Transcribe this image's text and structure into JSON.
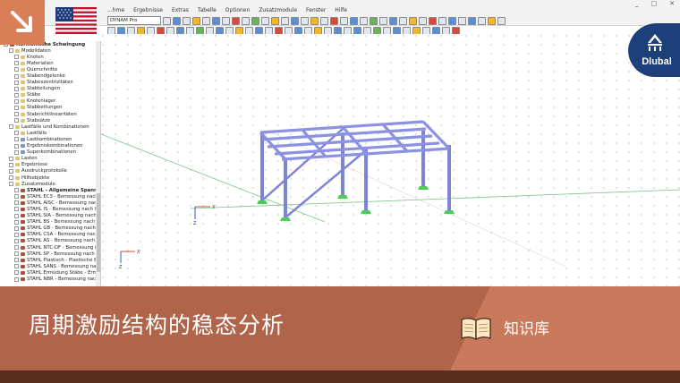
{
  "menu": {
    "items": [
      "...hme",
      "Ergebnisse",
      "Extras",
      "Tabelle",
      "Optionen",
      "Zusatzmodule",
      "Fenster",
      "Hilfe"
    ]
  },
  "window_controls": [
    "_",
    "□",
    "✕"
  ],
  "toolbar": {
    "model_select": "DYNAM Pro"
  },
  "sidebar": {
    "items": [
      {
        "label": "Harmonische Schwingung",
        "level": 0,
        "icon": "red",
        "bold": true
      },
      {
        "label": "Modelldaten",
        "level": 1,
        "icon": "folder"
      },
      {
        "label": "Knoten",
        "level": 2,
        "icon": "folder"
      },
      {
        "label": "Materialien",
        "level": 2,
        "icon": "folder"
      },
      {
        "label": "Querschnitte",
        "level": 2,
        "icon": "folder"
      },
      {
        "label": "Stabendgelenke",
        "level": 2,
        "icon": "folder"
      },
      {
        "label": "Stabexzentrizitäten",
        "level": 2,
        "icon": "folder"
      },
      {
        "label": "Stabteilungen",
        "level": 2,
        "icon": "folder"
      },
      {
        "label": "Stäbe",
        "level": 2,
        "icon": "folder"
      },
      {
        "label": "Knotenlager",
        "level": 2,
        "icon": "folder"
      },
      {
        "label": "Stabbettungen",
        "level": 2,
        "icon": "folder"
      },
      {
        "label": "Stabnichtlinearitäten",
        "level": 2,
        "icon": "folder"
      },
      {
        "label": "Stabsätze",
        "level": 2,
        "icon": "folder"
      },
      {
        "label": "Lastfälle und Kombinationen",
        "level": 1,
        "icon": "folder"
      },
      {
        "label": "Lastfälle",
        "level": 2,
        "icon": "folder"
      },
      {
        "label": "Lastkombinationen",
        "level": 2,
        "icon": "doc"
      },
      {
        "label": "Ergebniskombinationen",
        "level": 2,
        "icon": "doc"
      },
      {
        "label": "Superkombinationen",
        "level": 2,
        "icon": "doc"
      },
      {
        "label": "Lasten",
        "level": 1,
        "icon": "folder"
      },
      {
        "label": "Ergebnisse",
        "level": 1,
        "icon": "folder"
      },
      {
        "label": "Ausdruckprotokolle",
        "level": 1,
        "icon": "folder"
      },
      {
        "label": "Hilfsobjekte",
        "level": 1,
        "icon": "folder"
      },
      {
        "label": "Zusatzmodule",
        "level": 1,
        "icon": "folder"
      },
      {
        "label": "STAHL - Allgemeine Spannungsa",
        "level": 2,
        "icon": "red",
        "bold": true
      },
      {
        "label": "STAHL EC3 - Bemessung nach Eur",
        "level": 2,
        "icon": "red"
      },
      {
        "label": "STAHL AISC - Bemessung nach AI",
        "level": 2,
        "icon": "red"
      },
      {
        "label": "STAHL IS - Bemessung nach IS",
        "level": 2,
        "icon": "red"
      },
      {
        "label": "STAHL SIA - Bemessung nach SIA",
        "level": 2,
        "icon": "red"
      },
      {
        "label": "STAHL BS - Bemessung nach BS",
        "level": 2,
        "icon": "red"
      },
      {
        "label": "STAHL GB - Bemessung nach GB",
        "level": 2,
        "icon": "red"
      },
      {
        "label": "STAHL CSA - Bemessung nach CS",
        "level": 2,
        "icon": "red"
      },
      {
        "label": "STAHL AS - Bemessung nach AS",
        "level": 2,
        "icon": "red"
      },
      {
        "label": "STAHL NTC-DF - Bemessung nach",
        "level": 2,
        "icon": "red"
      },
      {
        "label": "STAHL SP - Bemessung nach SP",
        "level": 2,
        "icon": "red"
      },
      {
        "label": "STAHL Plastisch - Plastische Beme",
        "level": 2,
        "icon": "red"
      },
      {
        "label": "STAHL SANS - Bemessung nach S",
        "level": 2,
        "icon": "red"
      },
      {
        "label": "STAHL Ermüdung Stäbe - Ermüdu",
        "level": 2,
        "icon": "red"
      },
      {
        "label": "STAHL NBR - Bemessung nach NB",
        "level": 2,
        "icon": "red"
      }
    ]
  },
  "viewport": {
    "axis_labels": [
      "X",
      "Z",
      "X",
      "Z"
    ]
  },
  "brand": {
    "logo_text": "Dlubal",
    "accent": "#d97f58",
    "logo_color": "#1d3f7a"
  },
  "banner": {
    "title": "周期激励结构的稳态分析",
    "knowledge_base": "知识库",
    "color": "#b4654a"
  }
}
